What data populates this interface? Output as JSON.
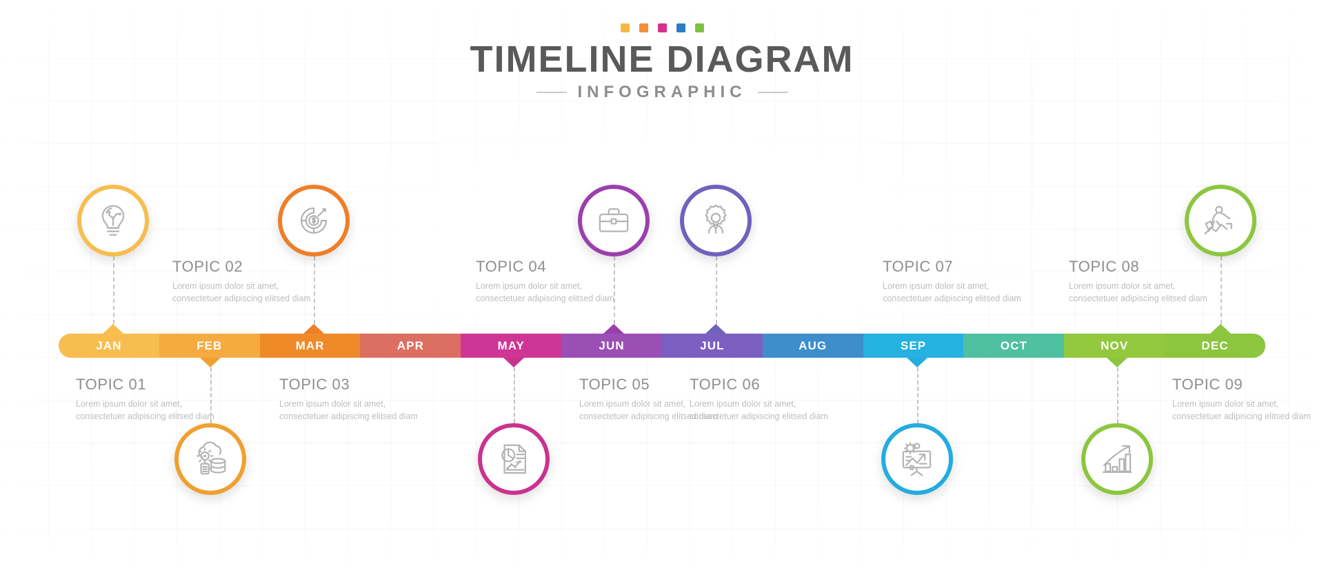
{
  "header": {
    "title": "TIMELINE DIAGRAM",
    "subtitle": "INFOGRAPHIC",
    "dots": [
      {
        "name": "dot-yellow",
        "color": "#f4b942"
      },
      {
        "name": "dot-orange",
        "color": "#f18f34"
      },
      {
        "name": "dot-magenta",
        "color": "#d62f8f"
      },
      {
        "name": "dot-blue",
        "color": "#2b7cc0"
      },
      {
        "name": "dot-green",
        "color": "#7ec242"
      }
    ]
  },
  "timeline": {
    "months": [
      {
        "label": "JAN",
        "color": "#f7bd4e"
      },
      {
        "label": "FEB",
        "color": "#f5ab40"
      },
      {
        "label": "MAR",
        "color": "#ef8a29"
      },
      {
        "label": "APR",
        "color": "#dd6f62"
      },
      {
        "label": "MAY",
        "color": "#cf3594"
      },
      {
        "label": "JUN",
        "color": "#9b4fb5"
      },
      {
        "label": "JUL",
        "color": "#7b5fc0"
      },
      {
        "label": "AUG",
        "color": "#3d8ecb"
      },
      {
        "label": "SEP",
        "color": "#25b2e0"
      },
      {
        "label": "OCT",
        "color": "#4fc0a0"
      },
      {
        "label": "NOV",
        "color": "#92c83e"
      },
      {
        "label": "DEC",
        "color": "#8cc63f"
      }
    ]
  },
  "desc_default": "Lorem ipsum dolor sit amet, consectetuer adipiscing elitsed diam",
  "topics": [
    {
      "title": "TOPIC 01",
      "desc": "Lorem ipsum dolor sit amet, consectetuer adipiscing elitsed diam",
      "month": "JAN",
      "position": "below",
      "color": "#f7bd4e",
      "icon": "lightbulb-idea-icon"
    },
    {
      "title": "TOPIC 02",
      "desc": "Lorem ipsum dolor sit amet, consectetuer adipiscing elitsed diam",
      "month": "FEB",
      "position": "above",
      "color": "#f0a02f",
      "icon": "cloud-database-icon"
    },
    {
      "title": "TOPIC 03",
      "desc": "Lorem ipsum dolor sit amet, consectetuer adipiscing elitsed diam",
      "month": "MAR",
      "position": "below",
      "color": "#ee7e27",
      "icon": "money-target-icon"
    },
    {
      "title": "TOPIC 04",
      "desc": "Lorem ipsum dolor sit amet, consectetuer adipiscing elitsed diam",
      "month": "MAY",
      "position": "above",
      "color": "#c9338f",
      "icon": "report-chart-icon"
    },
    {
      "title": "TOPIC 05",
      "desc": "Lorem ipsum dolor sit amet, consectetuer adipiscing elitsed diam",
      "month": "JUN",
      "position": "below",
      "color": "#9b3fae",
      "icon": "briefcase-icon"
    },
    {
      "title": "TOPIC 06",
      "desc": "Lorem ipsum dolor sit amet, consectetuer adipiscing elitsed diam",
      "month": "JUL",
      "position": "below",
      "color": "#6f62bd",
      "icon": "person-gear-icon"
    },
    {
      "title": "TOPIC 07",
      "desc": "Lorem ipsum dolor sit amet, consectetuer adipiscing elitsed diam",
      "month": "SEP",
      "position": "above",
      "color": "#23ace0",
      "icon": "presentation-growth-icon"
    },
    {
      "title": "TOPIC 08",
      "desc": "Lorem ipsum dolor sit amet, consectetuer adipiscing elitsed diam",
      "month": "NOV",
      "position": "above",
      "color": "#8cc63f",
      "icon": "bar-chart-growth-icon"
    },
    {
      "title": "TOPIC 09",
      "desc": "Lorem ipsum dolor sit amet, consectetuer adipiscing elitsed diam",
      "month": "DEC",
      "position": "below",
      "color": "#8cc63f",
      "icon": "businessman-growth-icon"
    }
  ],
  "icons": {
    "circles_above_bar": [
      "lightbulb-idea-icon",
      "money-target-icon",
      "briefcase-icon",
      "person-gear-icon",
      "businessman-growth-icon"
    ],
    "circles_below_bar": [
      "cloud-database-icon",
      "report-chart-icon",
      "presentation-growth-icon",
      "bar-chart-growth-icon"
    ]
  }
}
